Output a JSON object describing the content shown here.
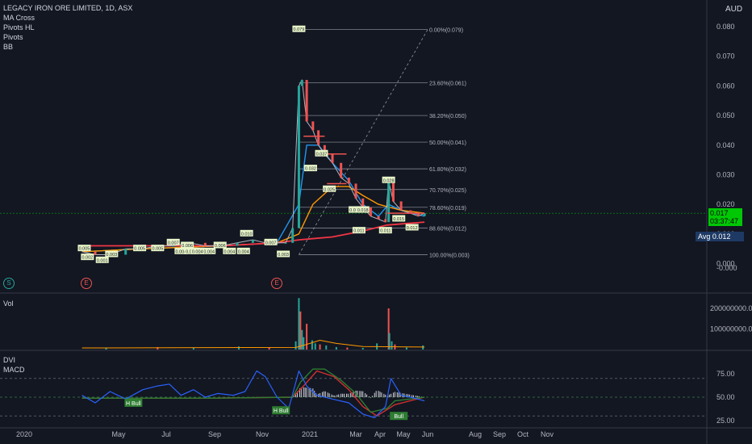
{
  "header": {
    "title": "LEGACY IRON ORE LIMITED, 1D, ASX",
    "indicators": [
      "MA Cross",
      "Pivots HL",
      "Pivots",
      "BB"
    ],
    "currency": "AUD"
  },
  "last_price": {
    "value": "0.017",
    "countdown": "03:37:47"
  },
  "avg_label": {
    "label": "Avg",
    "value": "0.012"
  },
  "events": [
    {
      "letter": "S",
      "color": "#26a69a"
    },
    {
      "letter": "E",
      "color": "#ef5350"
    },
    {
      "letter": "E",
      "color": "#ef5350"
    }
  ],
  "volume_pane": {
    "label": "Vol"
  },
  "indicator_pane": {
    "labels": [
      "DVI",
      "MACD"
    ]
  },
  "colors": {
    "background": "#131722",
    "up": "#26a69a",
    "down": "#ef5350",
    "price_line": "#b2b5be",
    "ma_fast": "#2196f3",
    "ma_slow": "#ff9800",
    "ma_long": "#f23645",
    "dvi": "#2962ff",
    "macd_line": "#2e7d32",
    "signal_line": "#d32f2f",
    "pivot_label_bg": "#e8f5c8",
    "bull_label_bg": "#2e7d32",
    "fib_line": "#9598a1",
    "last_price_bg": "#00c805"
  },
  "chart_data": [
    {
      "type": "line",
      "pane": "price",
      "title": "LEGACY IRON ORE LIMITED, 1D, ASX",
      "y_unit": "AUD",
      "ylim": [
        -0.008,
        0.085
      ],
      "y_ticks": [
        "0.080",
        "0.070",
        "0.060",
        "0.050",
        "0.040",
        "0.030",
        "0.020",
        "0.010",
        "0.000"
      ],
      "x_ticks": [
        "2020",
        "May",
        "Jul",
        "Sep",
        "Nov",
        "2021",
        "Mar",
        "Apr",
        "May",
        "Jun",
        "Aug",
        "Sep",
        "Oct",
        "Nov"
      ],
      "grid": false,
      "price_series": {
        "name": "Close",
        "x": [
          "2020-03-15",
          "2020-04-01",
          "2020-04-20",
          "2020-05-10",
          "2020-06-01",
          "2020-06-20",
          "2020-07-10",
          "2020-07-30",
          "2020-08-20",
          "2020-09-10",
          "2020-09-30",
          "2020-10-20",
          "2020-11-05",
          "2020-11-20",
          "2020-12-01",
          "2020-12-10",
          "2020-12-18",
          "2020-12-22",
          "2020-12-28",
          "2021-01-05",
          "2021-01-12",
          "2021-01-20",
          "2021-01-30",
          "2021-02-10",
          "2021-02-20",
          "2021-03-01",
          "2021-03-10",
          "2021-03-20",
          "2021-03-30",
          "2021-04-08",
          "2021-04-12",
          "2021-04-18",
          "2021-04-28",
          "2021-05-10",
          "2021-05-20",
          "2021-05-28"
        ],
        "y": [
          0.004,
          0.003,
          0.003,
          0.005,
          0.005,
          0.006,
          0.006,
          0.007,
          0.006,
          0.006,
          0.007,
          0.008,
          0.007,
          0.007,
          0.007,
          0.012,
          0.06,
          0.062,
          0.048,
          0.045,
          0.04,
          0.037,
          0.034,
          0.029,
          0.027,
          0.022,
          0.019,
          0.016,
          0.015,
          0.014,
          0.028,
          0.021,
          0.018,
          0.017,
          0.016,
          0.017
        ]
      },
      "ma_series": [
        {
          "name": "MA fast",
          "x": [
            "2020-03-15",
            "2020-06-01",
            "2020-09-10",
            "2020-11-20",
            "2020-12-18",
            "2020-12-28",
            "2021-01-12",
            "2021-01-30",
            "2021-02-20",
            "2021-03-10",
            "2021-03-30",
            "2021-04-12",
            "2021-04-28",
            "2021-05-28"
          ],
          "y": [
            0.004,
            0.005,
            0.006,
            0.007,
            0.02,
            0.04,
            0.04,
            0.034,
            0.028,
            0.02,
            0.016,
            0.02,
            0.018,
            0.016
          ]
        },
        {
          "name": "MA slow",
          "x": [
            "2020-03-15",
            "2020-06-01",
            "2020-09-10",
            "2020-11-20",
            "2020-12-18",
            "2021-01-05",
            "2021-01-30",
            "2021-02-20",
            "2021-03-10",
            "2021-03-30",
            "2021-04-28",
            "2021-05-28"
          ],
          "y": [
            0.004,
            0.005,
            0.006,
            0.007,
            0.01,
            0.02,
            0.026,
            0.026,
            0.023,
            0.02,
            0.018,
            0.017
          ]
        },
        {
          "name": "MA long",
          "x": [
            "2020-03-15",
            "2020-06-01",
            "2020-09-10",
            "2020-11-20",
            "2020-12-18",
            "2021-01-30",
            "2021-03-10",
            "2021-04-10",
            "2021-05-28"
          ],
          "y": [
            0.006,
            0.006,
            0.006,
            0.007,
            0.008,
            0.009,
            0.011,
            0.013,
            0.014
          ]
        }
      ],
      "fibonacci": [
        {
          "label": "0.00%(0.079)",
          "value": 0.079
        },
        {
          "label": "23.60%(0.061)",
          "value": 0.061
        },
        {
          "label": "38.20%(0.050)",
          "value": 0.05
        },
        {
          "label": "50.00%(0.041)",
          "value": 0.041
        },
        {
          "label": "61.80%(0.032)",
          "value": 0.032
        },
        {
          "label": "70.70%(0.025)",
          "value": 0.025
        },
        {
          "label": "78.60%(0.019)",
          "value": 0.019
        },
        {
          "label": "88.60%(0.012)",
          "value": 0.012
        },
        {
          "label": "100.00%(0.003)",
          "value": 0.003
        }
      ],
      "fib_start_date": "2020-12-18",
      "fib_end_date": "2021-06-01",
      "pivot_labels": [
        {
          "x": "2020-03-18",
          "y": 0.005,
          "text": "0.005"
        },
        {
          "x": "2020-03-22",
          "y": 0.002,
          "text": "0.002"
        },
        {
          "x": "2020-04-10",
          "y": 0.001,
          "text": "0.001"
        },
        {
          "x": "2020-04-22",
          "y": 0.003,
          "text": "0.003"
        },
        {
          "x": "2020-05-28",
          "y": 0.005,
          "text": "0.005"
        },
        {
          "x": "2020-06-20",
          "y": 0.005,
          "text": "0.005"
        },
        {
          "x": "2020-07-10",
          "y": 0.007,
          "text": "0.007"
        },
        {
          "x": "2020-07-20",
          "y": 0.004,
          "text": "0.004"
        },
        {
          "x": "2020-07-28",
          "y": 0.006,
          "text": "0.006"
        },
        {
          "x": "2020-08-02",
          "y": 0.004,
          "text": "0.004"
        },
        {
          "x": "2020-08-10",
          "y": 0.004,
          "text": "0.004"
        },
        {
          "x": "2020-08-25",
          "y": 0.004,
          "text": "0.004"
        },
        {
          "x": "2020-09-08",
          "y": 0.006,
          "text": "0.006"
        },
        {
          "x": "2020-09-20",
          "y": 0.004,
          "text": "0.004"
        },
        {
          "x": "2020-10-08",
          "y": 0.004,
          "text": "0.004"
        },
        {
          "x": "2020-10-12",
          "y": 0.01,
          "text": "0.010"
        },
        {
          "x": "2020-11-12",
          "y": 0.007,
          "text": "0.007"
        },
        {
          "x": "2020-11-28",
          "y": 0.003,
          "text": "0.003"
        },
        {
          "x": "2020-12-18",
          "y": 0.079,
          "text": "0.079"
        },
        {
          "x": "2021-01-16",
          "y": 0.037,
          "text": "0.037"
        },
        {
          "x": "2021-01-02",
          "y": 0.032,
          "text": "0.032"
        },
        {
          "x": "2021-01-26",
          "y": 0.025,
          "text": "0.025"
        },
        {
          "x": "2021-02-28",
          "y": 0.018,
          "text": "0.018"
        },
        {
          "x": "2021-03-10",
          "y": 0.018,
          "text": "0.018"
        },
        {
          "x": "2021-03-05",
          "y": 0.011,
          "text": "0.011"
        },
        {
          "x": "2021-04-08",
          "y": 0.011,
          "text": "0.011"
        },
        {
          "x": "2021-04-12",
          "y": 0.028,
          "text": "0.028"
        },
        {
          "x": "2021-04-25",
          "y": 0.015,
          "text": "0.015"
        },
        {
          "x": "2021-05-12",
          "y": 0.012,
          "text": "0.012"
        }
      ],
      "pivot_hl_lines": [
        {
          "x_from": "2020-12-24",
          "x_to": "2021-01-20",
          "y": 0.043
        },
        {
          "x_from": "2021-01-20",
          "x_to": "2021-02-17",
          "y": 0.037
        },
        {
          "x_from": "2021-01-23",
          "x_to": "2021-02-17",
          "y": 0.027
        },
        {
          "x_from": "2021-04-10",
          "x_to": "2021-05-28",
          "y": 0.017
        }
      ]
    },
    {
      "type": "bar",
      "pane": "volume",
      "title": "Vol",
      "y_ticks": [
        "200000000.0",
        "100000000.0"
      ],
      "ylim": [
        0,
        260000000
      ],
      "x": [
        "2020-04-15",
        "2020-06-20",
        "2020-08-05",
        "2020-10-02",
        "2020-11-10",
        "2020-12-14",
        "2020-12-18",
        "2020-12-20",
        "2020-12-22",
        "2020-12-24",
        "2020-12-28",
        "2021-01-04",
        "2021-01-08",
        "2021-01-14",
        "2021-01-22",
        "2021-02-04",
        "2021-02-18",
        "2021-03-10",
        "2021-03-28",
        "2021-04-12",
        "2021-04-13",
        "2021-04-16",
        "2021-04-20",
        "2021-05-05",
        "2021-05-26"
      ],
      "values": [
        10000000,
        12000000,
        8000000,
        15000000,
        9000000,
        40000000,
        250000000,
        185000000,
        95000000,
        60000000,
        125000000,
        45000000,
        30000000,
        25000000,
        20000000,
        12000000,
        10000000,
        8000000,
        30000000,
        200000000,
        80000000,
        40000000,
        25000000,
        10000000,
        20000000
      ],
      "ma": {
        "x": [
          "2020-03-15",
          "2020-12-14",
          "2020-12-28",
          "2021-01-14",
          "2021-02-04",
          "2021-03-10",
          "2021-05-28"
        ],
        "values": [
          8000000,
          10000000,
          25000000,
          45000000,
          30000000,
          15000000,
          12000000
        ]
      }
    },
    {
      "type": "line",
      "pane": "indicator",
      "title": "DVI MACD",
      "y_ticks": [
        "75.00",
        "50.00",
        "25.00"
      ],
      "ylim": [
        20,
        85
      ],
      "reference_lines": [
        70,
        50,
        30
      ],
      "dvi": {
        "x": [
          "2020-03-15",
          "2020-04-01",
          "2020-04-20",
          "2020-05-10",
          "2020-06-01",
          "2020-06-20",
          "2020-07-05",
          "2020-07-20",
          "2020-08-05",
          "2020-08-20",
          "2020-09-05",
          "2020-09-25",
          "2020-10-10",
          "2020-10-25",
          "2020-11-05",
          "2020-11-20",
          "2020-12-05",
          "2020-12-18",
          "2020-12-28",
          "2021-01-10",
          "2021-01-30",
          "2021-02-20",
          "2021-03-10",
          "2021-03-25",
          "2021-04-08",
          "2021-04-15",
          "2021-04-28",
          "2021-05-10",
          "2021-05-28"
        ],
        "y": [
          52,
          44,
          56,
          48,
          58,
          62,
          64,
          52,
          58,
          50,
          54,
          52,
          56,
          78,
          72,
          50,
          38,
          78,
          62,
          52,
          48,
          44,
          32,
          28,
          40,
          70,
          52,
          50,
          46
        ]
      },
      "macd": {
        "x": [
          "2020-03-15",
          "2020-09-01",
          "2020-12-10",
          "2020-12-20",
          "2021-01-05",
          "2021-01-20",
          "2021-02-10",
          "2021-03-01",
          "2021-03-20",
          "2021-04-10",
          "2021-04-20",
          "2021-05-28"
        ],
        "y": [
          49,
          49,
          50,
          66,
          80,
          80,
          68,
          54,
          34,
          38,
          46,
          50
        ]
      },
      "signal": {
        "x": [
          "2020-03-15",
          "2020-09-01",
          "2020-12-10",
          "2020-12-24",
          "2021-01-10",
          "2021-02-01",
          "2021-02-20",
          "2021-03-10",
          "2021-03-28",
          "2021-04-20",
          "2021-05-28"
        ],
        "y": [
          49,
          49,
          50,
          62,
          78,
          72,
          58,
          40,
          30,
          42,
          50
        ]
      },
      "labels": [
        {
          "x": "2020-05-20",
          "y": 44,
          "text": "H Bull"
        },
        {
          "x": "2020-11-25",
          "y": 36,
          "text": "H Bull"
        },
        {
          "x": "2021-04-25",
          "y": 30,
          "text": "Bull"
        }
      ]
    }
  ]
}
